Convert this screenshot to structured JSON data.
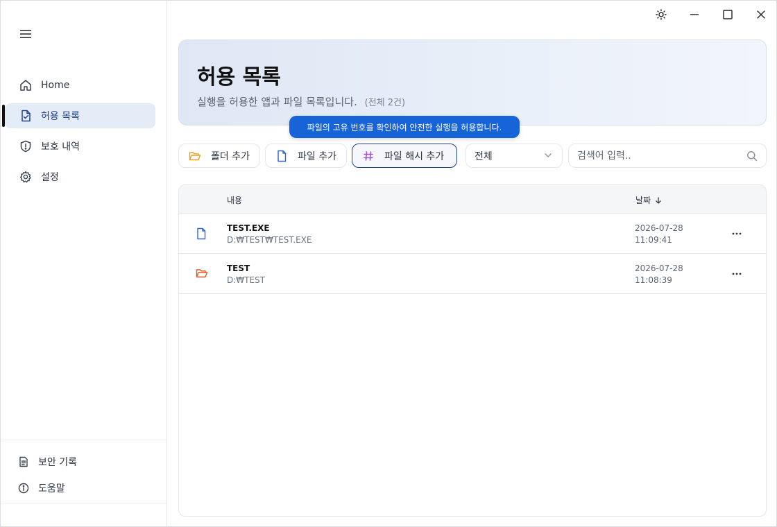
{
  "sidebar": {
    "items": [
      {
        "label": "Home",
        "icon": "home-icon"
      },
      {
        "label": "허용 목록",
        "icon": "file-check-icon",
        "active": true
      },
      {
        "label": "보호 내역",
        "icon": "shield-alert-icon"
      },
      {
        "label": "설정",
        "icon": "gear-icon"
      }
    ],
    "bottom": [
      {
        "label": "보안 기록",
        "icon": "document-icon"
      },
      {
        "label": "도움말",
        "icon": "info-icon"
      }
    ]
  },
  "header": {
    "title": "허용 목록",
    "subtitle": "실행을 허용한 앱과 파일 목록입니다.",
    "count": "(전체 2건)"
  },
  "tooltip": "파일의 고유 번호를 확인하여 안전한 실행을 허용합니다.",
  "toolbar": {
    "add_folder": "폴더 추가",
    "add_file": "파일 추가",
    "add_hash": "파일 해시 추가",
    "filter_value": "전체",
    "search_placeholder": "검색어 입력.."
  },
  "table": {
    "col_content": "내용",
    "col_date": "날짜",
    "rows": [
      {
        "name": "TEST.EXE",
        "path": "D:₩TEST₩TEST.EXE",
        "date": "2026-07-28",
        "time": "11:09:41",
        "type": "file"
      },
      {
        "name": "TEST",
        "path": "D:₩TEST",
        "date": "2026-07-28",
        "time": "11:08:39",
        "type": "folder"
      }
    ]
  },
  "colors": {
    "accent": "#1763d8",
    "active_nav_bg": "#e4ecf8",
    "folder_icon": "#e8a21a",
    "folder_row_icon": "#e0571f",
    "file_icon": "#2a63d8",
    "hash_icon": "#a24fd6"
  }
}
